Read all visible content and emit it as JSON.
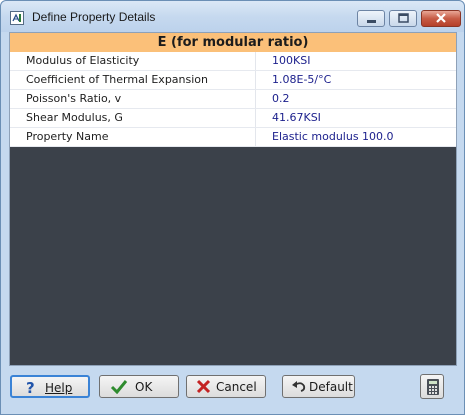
{
  "window": {
    "title": "Define Property Details",
    "app_icon": "app-icon",
    "controls": [
      "minimize-icon",
      "maximize-icon",
      "close-icon"
    ]
  },
  "header": {
    "title": "E (for modular ratio)"
  },
  "properties": [
    {
      "label": "Modulus of Elasticity",
      "value": "100KSI"
    },
    {
      "label": "Coefficient of Thermal Expansion",
      "value": "1.08E-5/°C"
    },
    {
      "label": "Poisson's Ratio, v",
      "value": "0.2"
    },
    {
      "label": "Shear Modulus, G",
      "value": "41.67KSI"
    },
    {
      "label": "Property Name",
      "value": "Elastic modulus 100.0"
    }
  ],
  "buttons": {
    "help": "Help",
    "ok": "OK",
    "cancel": "Cancel",
    "default": "Default"
  },
  "colors": {
    "header_band": "#fbc079",
    "value_text": "#1b1f8c",
    "empty_area": "#3b414a",
    "frame": "#c5d9ef"
  }
}
